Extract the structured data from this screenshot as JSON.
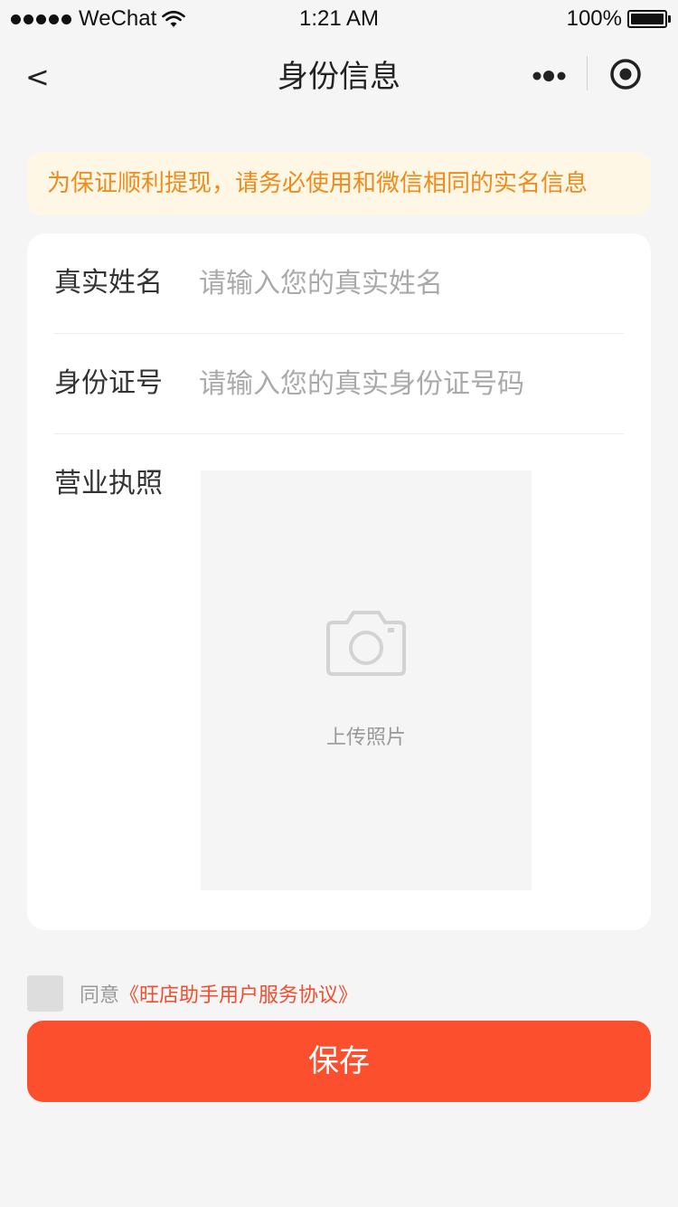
{
  "status_bar": {
    "carrier": "WeChat",
    "time": "1:21 AM",
    "battery": "100%"
  },
  "nav": {
    "back": "<",
    "title": "身份信息",
    "icons": [
      "more-icon",
      "record-icon"
    ]
  },
  "notice": {
    "text": "为保证顺利提现，请务必使用和微信相同的实名信息",
    "color": "#f08a1b",
    "background": "#fff7e6"
  },
  "form": {
    "name": {
      "label": "真实姓名",
      "placeholder": "请输入您的真实姓名",
      "value": ""
    },
    "id_number": {
      "label": "身份证号",
      "placeholder": "请输入您的真实身份证号码",
      "value": ""
    },
    "license": {
      "label": "营业执照",
      "upload_text": "上传照片",
      "icon": "camera-icon"
    }
  },
  "agreement": {
    "prefix": "同意",
    "link": "《旺店助手用户服务协议》",
    "checked": false
  },
  "save_button": {
    "label": "保存",
    "color": "#fb4f2e"
  }
}
